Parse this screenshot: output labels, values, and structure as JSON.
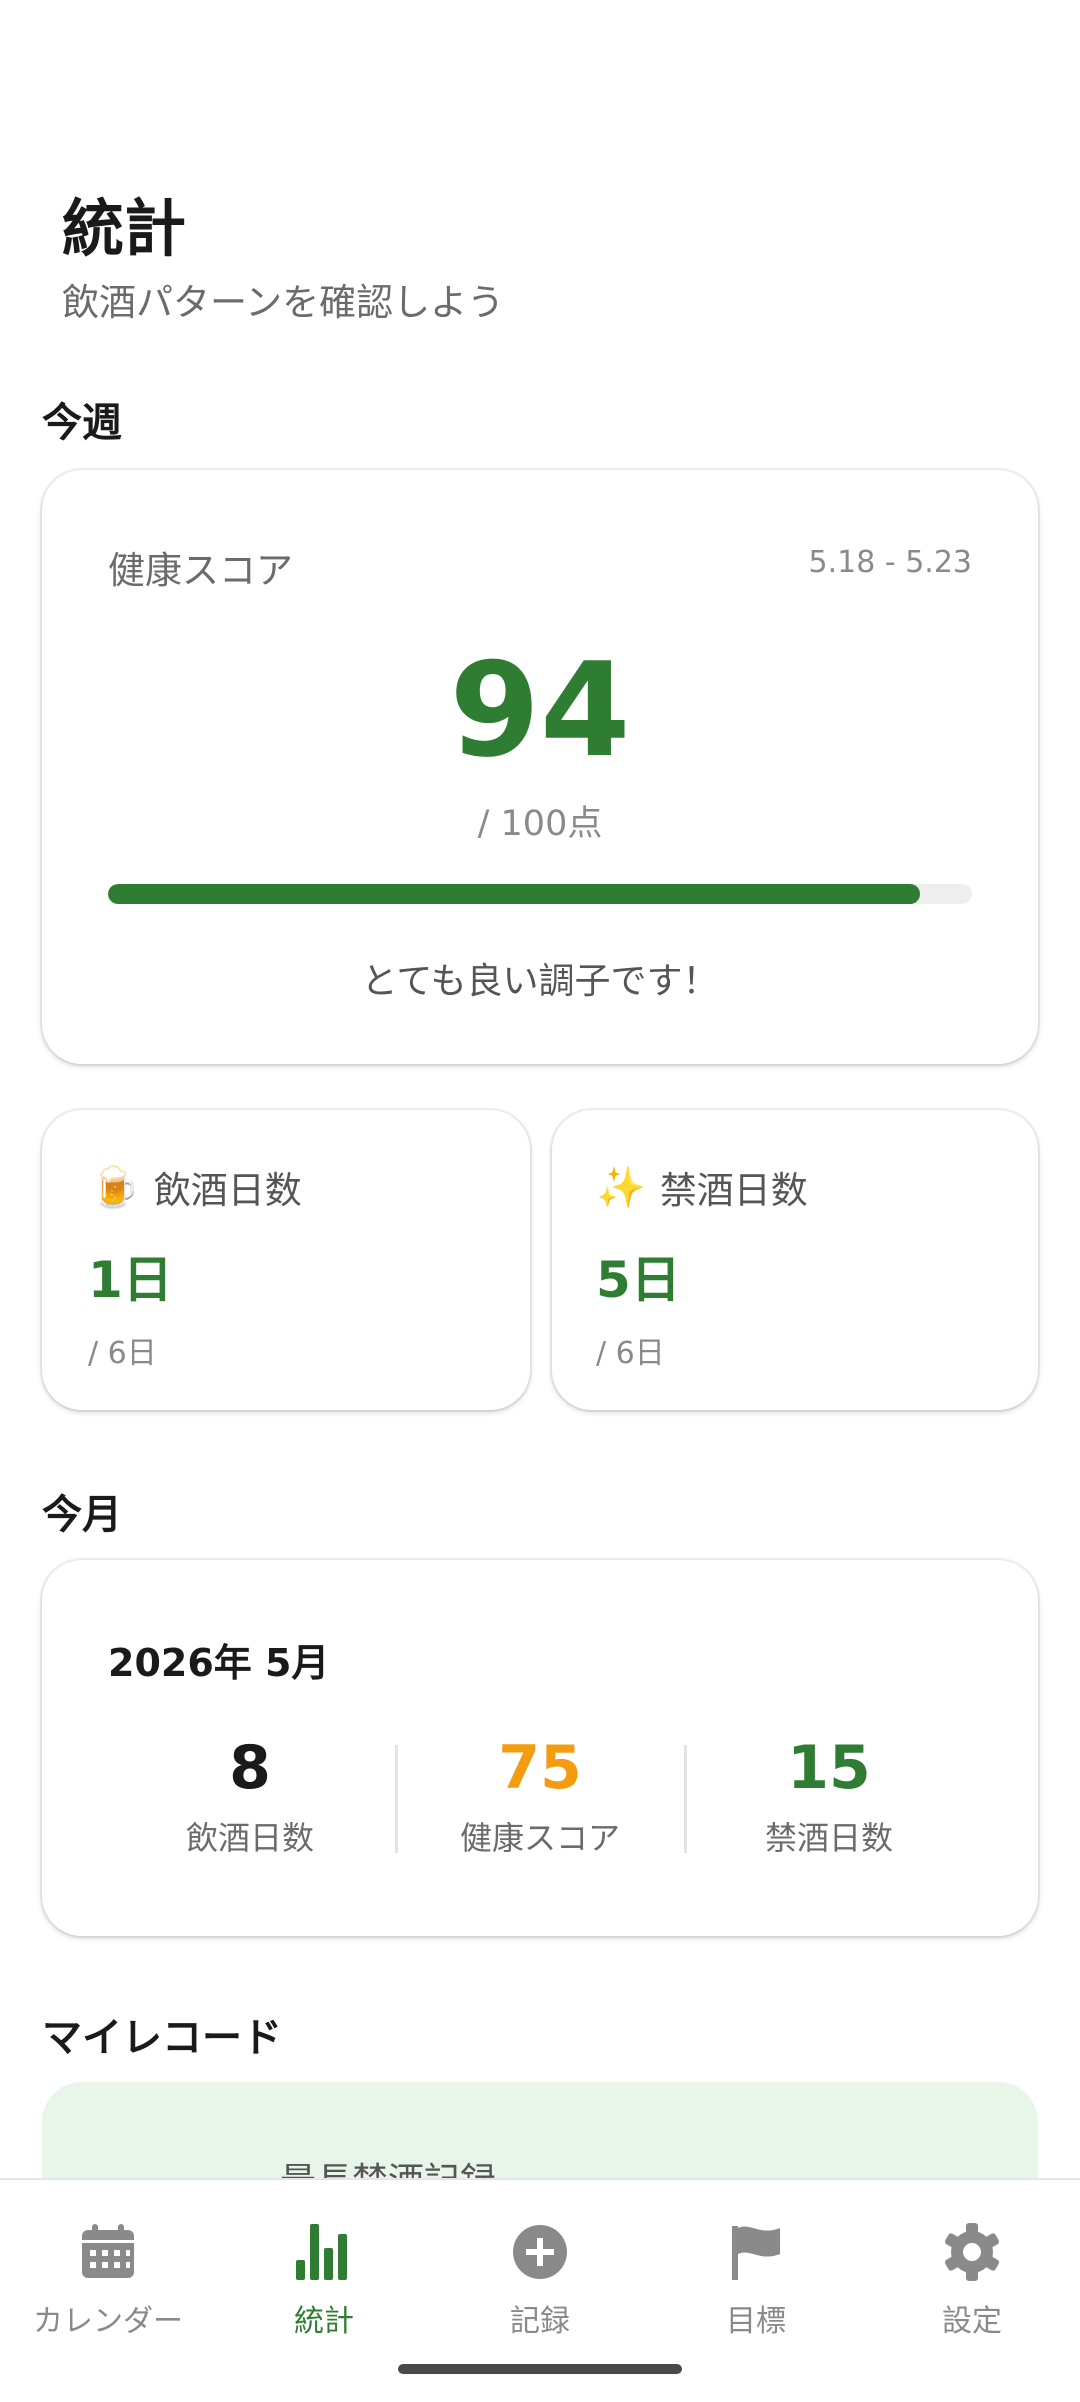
{
  "header": {
    "title": "統計",
    "subtitle": "飲酒パターンを確認しよう"
  },
  "week": {
    "section_title": "今週",
    "health_score": {
      "label": "健康スコア",
      "date_range": "5.18 - 5.23",
      "score": "94",
      "max_label": "/ 100点",
      "progress_percent": 94,
      "message": "とても良い調子です！"
    },
    "drinking_days": {
      "emoji": "🍺",
      "label": "飲酒日数",
      "value": "1日",
      "total": "/ 6日"
    },
    "sober_days": {
      "emoji": "✨",
      "label": "禁酒日数",
      "value": "5日",
      "total": "/ 6日"
    }
  },
  "month": {
    "section_title": "今月",
    "period": "2026年 5月",
    "drinking_days": {
      "value": "8",
      "label": "飲酒日数"
    },
    "health_score": {
      "value": "75",
      "label": "健康スコア"
    },
    "sober_days": {
      "value": "15",
      "label": "禁酒日数"
    }
  },
  "records": {
    "section_title": "マイレコード",
    "longest_sober_label": "最長禁酒記録"
  },
  "nav": {
    "items": [
      {
        "label": "カレンダー",
        "icon": "calendar-icon"
      },
      {
        "label": "統計",
        "icon": "bar-chart-icon"
      },
      {
        "label": "記録",
        "icon": "add-circle-icon"
      },
      {
        "label": "目標",
        "icon": "flag-icon"
      },
      {
        "label": "設定",
        "icon": "gear-icon"
      }
    ],
    "active_index": 1
  },
  "colors": {
    "primary_green": "#2e7d32",
    "score_orange": "#f39c12",
    "record_bg": "#e8f5e9"
  }
}
